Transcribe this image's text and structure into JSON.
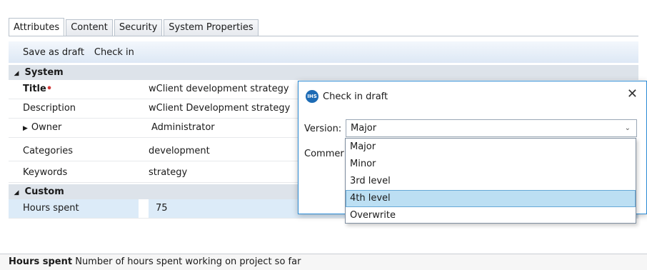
{
  "tabs": [
    "Attributes",
    "Content",
    "Security",
    "System Properties"
  ],
  "toolbar": {
    "save_draft": "Save as draft",
    "check_in": "Check in"
  },
  "sections": {
    "system": "System",
    "custom": "Custom"
  },
  "rows": {
    "title": {
      "label": "Title",
      "required_marker": "•",
      "value": "wClient development strategy"
    },
    "description": {
      "label": "Description",
      "value": "wClient Development strategy"
    },
    "owner": {
      "label": "Owner",
      "value": "Administrator"
    },
    "categories": {
      "label": "Categories",
      "value": "development"
    },
    "keywords": {
      "label": "Keywords",
      "value": "strategy"
    },
    "hours": {
      "label": "Hours spent",
      "value": "75"
    }
  },
  "statusbar": {
    "field": "Hours spent",
    "description": "Number of hours spent working on project so far"
  },
  "dialog": {
    "logo_text": "IHS",
    "title": "Check in draft",
    "version_label": "Version:",
    "version_selected": "Major",
    "comment_label": "Commer",
    "options": [
      "Major",
      "Minor",
      "3rd level",
      "4th level",
      "Overwrite"
    ],
    "highlighted_option": "4th level"
  },
  "colors": {
    "accent": "#2a8ad4",
    "selection": "#bcdff3",
    "row_selected": "#dcebf8"
  }
}
